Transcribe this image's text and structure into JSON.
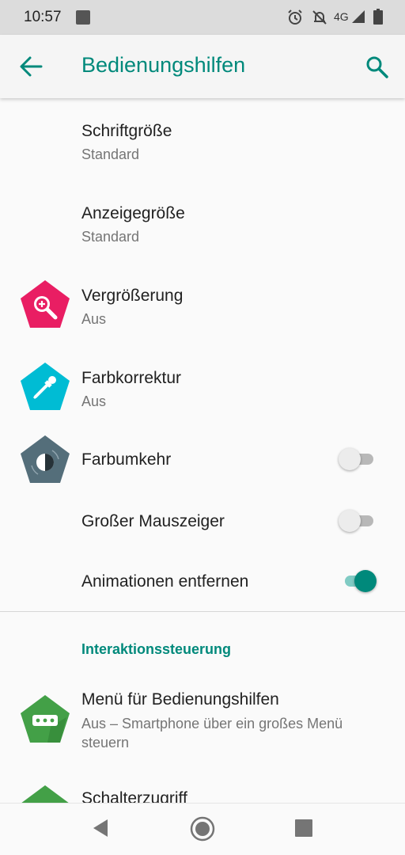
{
  "status_bar": {
    "time": "10:57",
    "network": "4G",
    "icons": [
      "notification-square-icon",
      "alarm-icon",
      "notifications-off-icon",
      "cell-signal-icon",
      "battery-icon"
    ]
  },
  "toolbar": {
    "title": "Bedienungshilfen",
    "back_icon": "arrow-left-icon",
    "search_icon": "search-icon"
  },
  "items": [
    {
      "title": "Schriftgröße",
      "summary": "Standard"
    },
    {
      "title": "Anzeigegröße",
      "summary": "Standard"
    },
    {
      "title": "Vergrößerung",
      "summary": "Aus",
      "icon": "magnification-icon"
    },
    {
      "title": "Farbkorrektur",
      "summary": "Aus",
      "icon": "color-correction-icon"
    },
    {
      "title": "Farbumkehr",
      "icon": "color-inversion-icon",
      "switch": false
    },
    {
      "title": "Großer Mauszeiger",
      "switch": false
    },
    {
      "title": "Animationen entfernen",
      "switch": true
    }
  ],
  "section": {
    "title": "Interaktionssteuerung",
    "items": [
      {
        "title": "Menü für Bedienungshilfen",
        "summary_line1": "Aus – Smartphone über ein großes Menü",
        "summary_line2": "steuern",
        "icon": "accessibility-menu-icon"
      },
      {
        "title": "Schalterzugriff",
        "icon": "switch-access-icon"
      }
    ]
  },
  "colors": {
    "accent": "#00897b",
    "magnification": "#e91e63",
    "color_correction": "#00bcd4",
    "color_inversion": "#546e7a",
    "accessibility_menu": "#43a047"
  },
  "nav_bar": {
    "icons": [
      "nav-back-icon",
      "nav-home-icon",
      "nav-recents-icon"
    ]
  }
}
